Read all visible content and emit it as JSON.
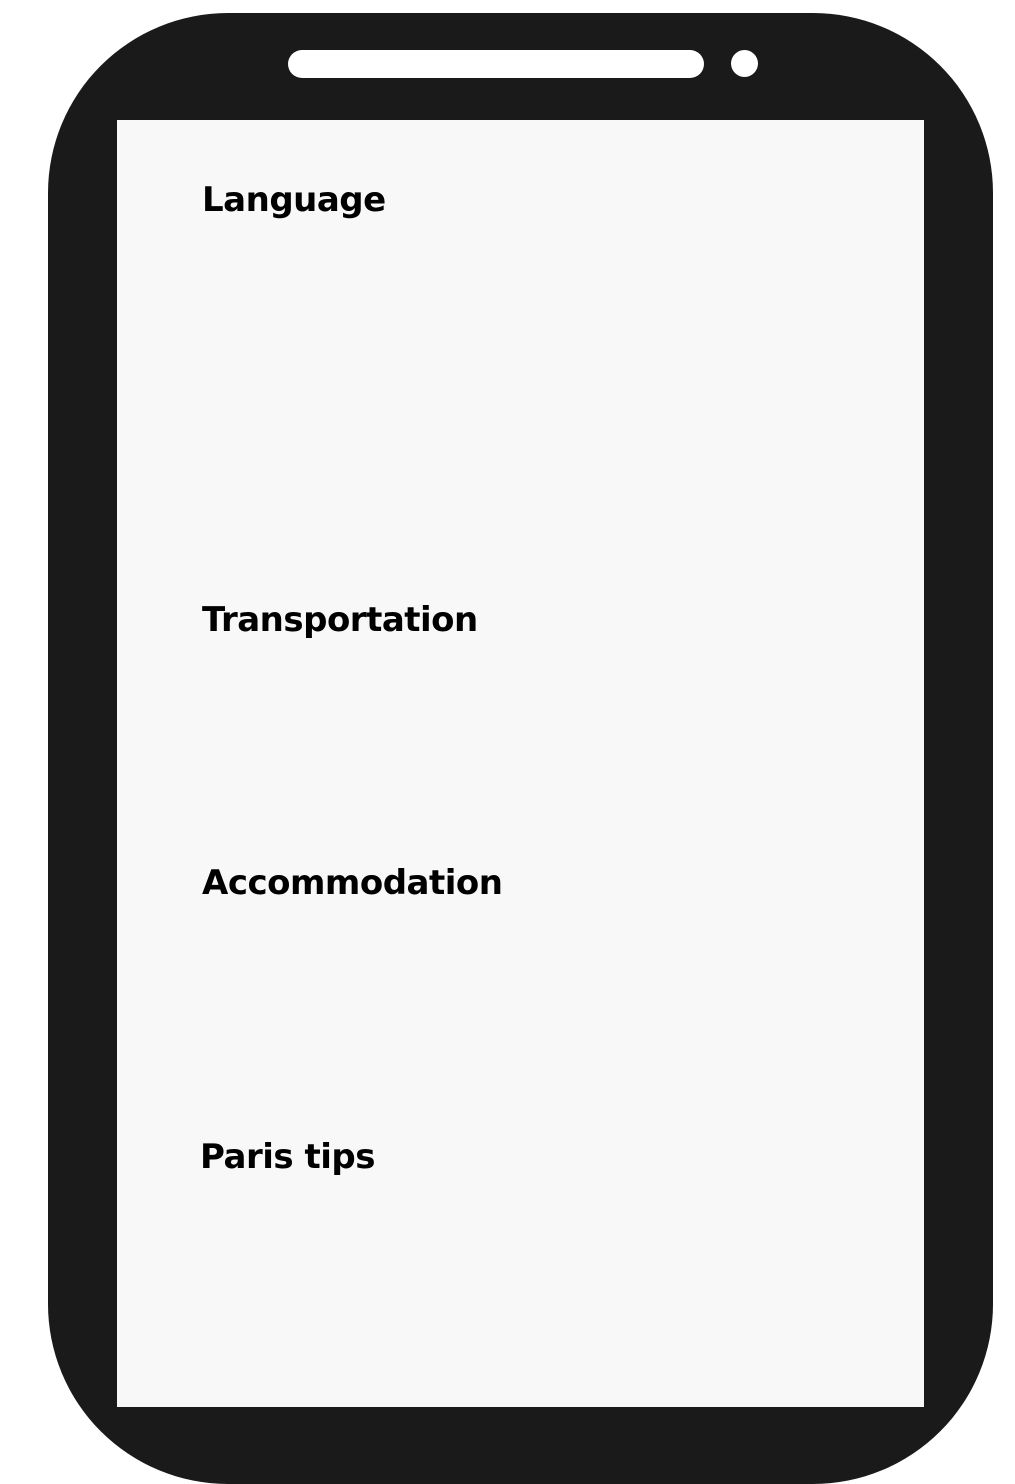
{
  "device": {
    "frame_color": "#1a1a1a",
    "screen_color": "#f8f8f8"
  },
  "menu": {
    "items": [
      {
        "label": "Language"
      },
      {
        "label": "Transportation"
      },
      {
        "label": "Accommodation"
      },
      {
        "label": "Paris tips"
      }
    ]
  }
}
